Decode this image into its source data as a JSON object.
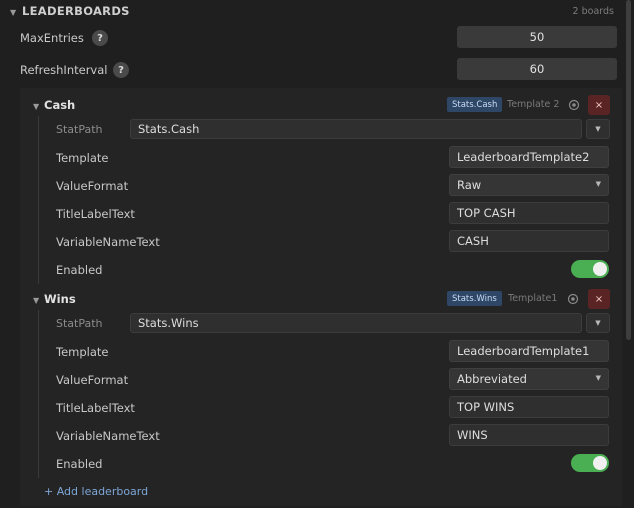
{
  "section": {
    "title": "LEADERBOARDS",
    "count": "2 boards"
  },
  "settings": [
    {
      "label": "MaxEntries",
      "help": "?",
      "value": "50"
    },
    {
      "label": "RefreshInterval",
      "help": "?",
      "value": "60"
    }
  ],
  "boards": [
    {
      "name": "Cash",
      "tag": "Stats.Cash",
      "template_name": "Template 2",
      "remove": "×",
      "stat_path": {
        "label": "StatPath",
        "value": "Stats.Cash"
      },
      "template": {
        "label": "Template",
        "value": "LeaderboardTemplate2"
      },
      "value_format": {
        "label": "ValueFormat",
        "value": "Raw"
      },
      "title_label": {
        "label": "TitleLabelText",
        "value": "TOP CASH"
      },
      "variable_name": {
        "label": "VariableNameText",
        "value": "CASH"
      },
      "enabled": {
        "label": "Enabled",
        "on": true
      }
    },
    {
      "name": "Wins",
      "tag": "Stats.Wins",
      "template_name": "Template1",
      "remove": "×",
      "stat_path": {
        "label": "StatPath",
        "value": "Stats.Wins"
      },
      "template": {
        "label": "Template",
        "value": "LeaderboardTemplate1"
      },
      "value_format": {
        "label": "ValueFormat",
        "value": "Abbreviated"
      },
      "title_label": {
        "label": "TitleLabelText",
        "value": "TOP WINS"
      },
      "variable_name": {
        "label": "VariableNameText",
        "value": "WINS"
      },
      "enabled": {
        "label": "Enabled",
        "on": true
      }
    }
  ],
  "add_label": "+ Add leaderboard",
  "icons": {
    "caret": "caret-down-icon",
    "gear": "gear-icon",
    "close": "close-icon",
    "dropdown": "chevron-down-icon",
    "help": "help-icon"
  },
  "colors": {
    "toggle_on": "#4aae52",
    "tag_bg": "#2f4766",
    "remove_bg": "#5a2424",
    "link": "#7da6d6"
  }
}
